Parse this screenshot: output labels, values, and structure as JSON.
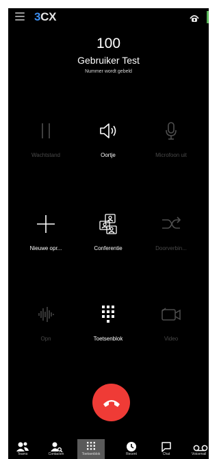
{
  "app": {
    "logo_prefix": "3",
    "logo_suffix": "CX"
  },
  "call": {
    "extension": "100",
    "name": "Gebruiker Test",
    "status": "Nummer wordt gebeld"
  },
  "controls": [
    {
      "label": "Wachtstand",
      "icon": "pause-icon",
      "enabled": false
    },
    {
      "label": "Oortje",
      "icon": "speaker-icon",
      "enabled": true
    },
    {
      "label": "Microfoon uit",
      "icon": "microphone-icon",
      "enabled": false
    },
    {
      "label": "Nieuwe opr...",
      "icon": "plus-icon",
      "enabled": true
    },
    {
      "label": "Conferentie",
      "icon": "conference-icon",
      "enabled": true
    },
    {
      "label": "Doorverbin...",
      "icon": "transfer-icon",
      "enabled": false
    },
    {
      "label": "Opn",
      "icon": "record-waveform-icon",
      "enabled": false
    },
    {
      "label": "Toetsenblok",
      "icon": "keypad-icon",
      "enabled": true
    },
    {
      "label": "Video",
      "icon": "video-camera-icon",
      "enabled": false
    }
  ],
  "hangup": {
    "icon": "hangup-icon",
    "color": "#ef3b36"
  },
  "nav": [
    {
      "label": "Teams",
      "icon": "people-icon",
      "active": false
    },
    {
      "label": "Contacten",
      "icon": "contacts-icon",
      "active": false
    },
    {
      "label": "Toetsenblok",
      "icon": "dialpad-icon",
      "active": true
    },
    {
      "label": "Recent",
      "icon": "clock-icon",
      "active": false
    },
    {
      "label": "Chat",
      "icon": "chat-icon",
      "active": false
    },
    {
      "label": "Voicemail",
      "icon": "voicemail-icon",
      "active": false
    }
  ],
  "colors": {
    "accent": "#3d8ef0",
    "background": "#000000",
    "presence": "#5cb85c",
    "disabled": "#4a4a4a"
  }
}
